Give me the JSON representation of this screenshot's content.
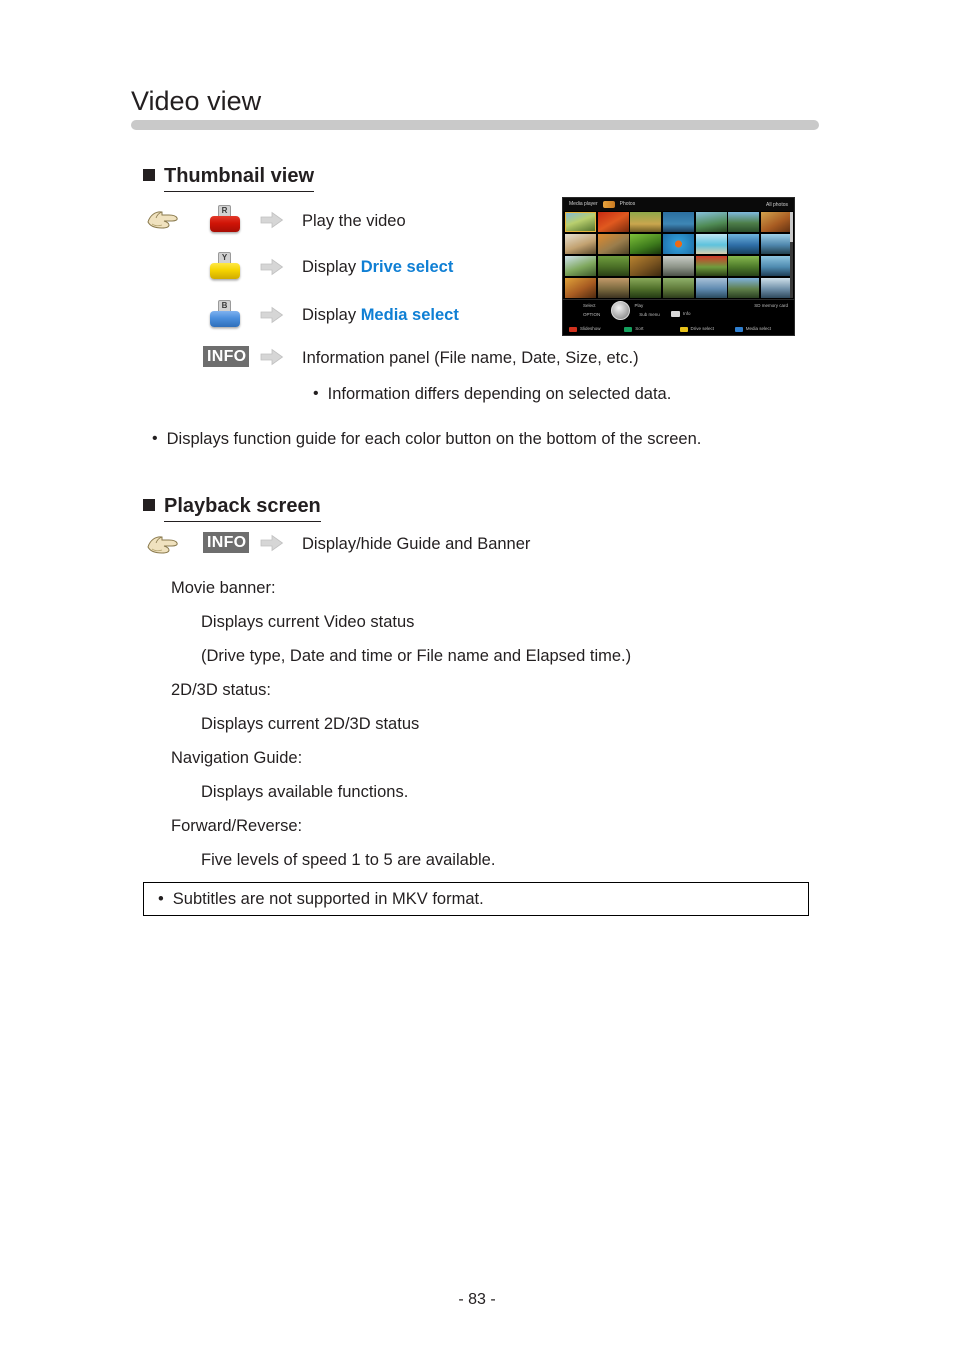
{
  "page": {
    "title": "Video view",
    "footer": "- 83 -"
  },
  "sections": {
    "thumbnail": {
      "heading": "Thumbnail view",
      "rows": [
        {
          "button": "red",
          "button_letter": "R",
          "text_prefix": "Play the video",
          "text_link": ""
        },
        {
          "button": "yellow",
          "button_letter": "Y",
          "text_prefix": "Display ",
          "text_link": "Drive select"
        },
        {
          "button": "blue",
          "button_letter": "B",
          "text_prefix": "Display ",
          "text_link": "Media select"
        },
        {
          "button": "info",
          "button_letter": "INFO",
          "text_prefix": "Information panel (File name, Date, Size, etc.)",
          "text_link": ""
        }
      ],
      "sub_note": "Information differs depending on selected data.",
      "note": "Displays function guide for each color button on the bottom of the screen."
    },
    "playback": {
      "heading": "Playback screen",
      "info_label": "INFO",
      "info_text": "Display/hide Guide and Banner",
      "items": [
        {
          "term": "Movie banner:",
          "lines": [
            "Displays current Video status",
            "(Drive type, Date and time or File name and Elapsed time.)"
          ]
        },
        {
          "term": "2D/3D status:",
          "lines": [
            "Displays current 2D/3D status"
          ]
        },
        {
          "term": "Navigation Guide:",
          "lines": [
            "Displays available functions."
          ]
        },
        {
          "term": "Forward/Reverse:",
          "lines": [
            "Five levels of speed 1 to 5 are available."
          ]
        }
      ],
      "note_box": "Subtitles are not supported in MKV format."
    }
  },
  "tv_screenshot": {
    "topbar": {
      "app": "Media player",
      "mode": "Photos",
      "right": "All photos"
    },
    "bottom": {
      "select": "Select",
      "play": "Play",
      "options": "OPTION",
      "info": "Info",
      "media": "SD memory card",
      "sub_menu": "Sub menu",
      "color_buttons": [
        {
          "color": "red",
          "label": "Slideshow"
        },
        {
          "color": "green",
          "label": "Sort"
        },
        {
          "color": "yellow",
          "label": "Drive select"
        },
        {
          "color": "blue",
          "label": "Media select"
        }
      ]
    }
  },
  "icons": {
    "hand": "pointing-hand-icon",
    "arrow": "right-arrow-icon"
  },
  "colors": {
    "link_blue": "#0f7fd4",
    "rule_grey": "#c9c9c9",
    "info_badge_bg": "#6e6e6e",
    "button_red": "#d01407",
    "button_yellow": "#f5d400",
    "button_blue": "#4b8fdd"
  }
}
